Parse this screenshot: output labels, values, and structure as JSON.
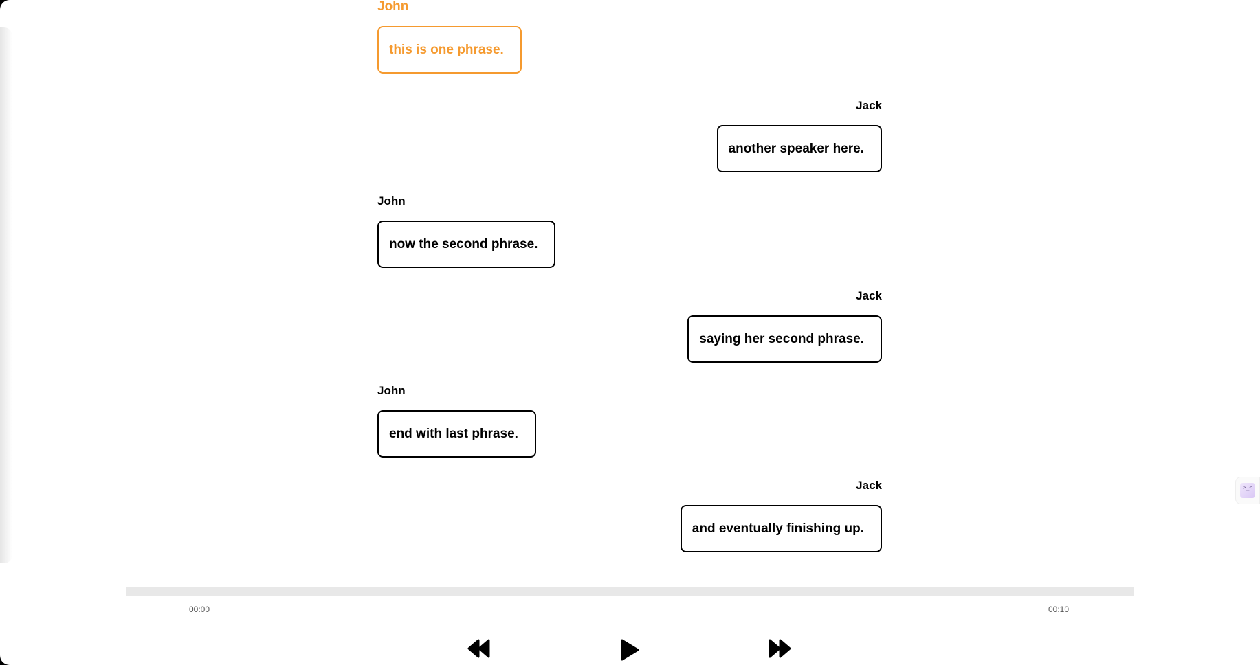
{
  "transcript": {
    "messages": [
      {
        "speaker": "John",
        "text": "this is one phrase.",
        "side": "left",
        "active": true
      },
      {
        "speaker": "Jack",
        "text": "another speaker here.",
        "side": "right",
        "active": false
      },
      {
        "speaker": "John",
        "text": "now the second phrase.",
        "side": "left",
        "active": false
      },
      {
        "speaker": "Jack",
        "text": "saying her second phrase.",
        "side": "right",
        "active": false
      },
      {
        "speaker": "John",
        "text": "end with last phrase.",
        "side": "left",
        "active": false
      },
      {
        "speaker": "Jack",
        "text": "and eventually finishing up.",
        "side": "right",
        "active": false
      }
    ]
  },
  "player": {
    "current_time": "00:00",
    "duration": "00:10",
    "progress": 0,
    "icons": {
      "rewind": "rewind-icon",
      "play": "play-icon",
      "forward": "fast-forward-icon"
    }
  },
  "side_widget": {
    "glyph": ">_<",
    "icon": "extension-icon"
  },
  "colors": {
    "active": "#f59a2f",
    "default": "#000000",
    "track": "#e8e8e8"
  }
}
